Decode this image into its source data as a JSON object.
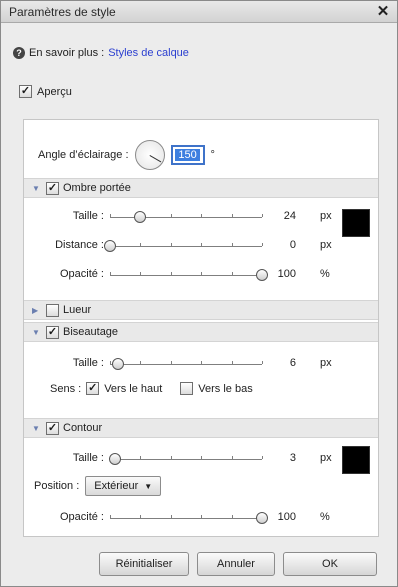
{
  "window": {
    "title": "Paramètres de style"
  },
  "learn_more": {
    "prefix": "En savoir plus :",
    "link": "Styles de calque"
  },
  "preview": {
    "label": "Aperçu",
    "checked": "✓"
  },
  "lighting": {
    "label": "Angle d’éclairage :",
    "value": "150",
    "unit": "°"
  },
  "sections": {
    "drop_shadow": {
      "title": "Ombre portée",
      "checked": "✓",
      "size": {
        "label": "Taille :",
        "value": "24",
        "unit": "px",
        "level": 0.2
      },
      "distance": {
        "label": "Distance :",
        "value": "0",
        "unit": "px",
        "level": 0.0
      },
      "opacity": {
        "label": "Opacité :",
        "value": "100",
        "unit": "%",
        "level": 1.0
      },
      "color": "#000000"
    },
    "glow": {
      "title": "Lueur",
      "checked": ""
    },
    "bevel": {
      "title": "Biseautage",
      "checked": "✓",
      "size": {
        "label": "Taille :",
        "value": "6",
        "unit": "px",
        "level": 0.05
      },
      "direction": {
        "label": "Sens :",
        "up": "Vers le haut",
        "up_checked": "✓",
        "down": "Vers le bas",
        "down_checked": ""
      }
    },
    "stroke": {
      "title": "Contour",
      "checked": "✓",
      "size": {
        "label": "Taille :",
        "value": "3",
        "unit": "px",
        "level": 0.03
      },
      "position": {
        "label": "Position :",
        "value": "Extérieur"
      },
      "opacity": {
        "label": "Opacité :",
        "value": "100",
        "unit": "%",
        "level": 1.0
      },
      "color": "#000000"
    }
  },
  "buttons": {
    "reset": "Réinitialiser",
    "cancel": "Annuler",
    "ok": "OK"
  }
}
